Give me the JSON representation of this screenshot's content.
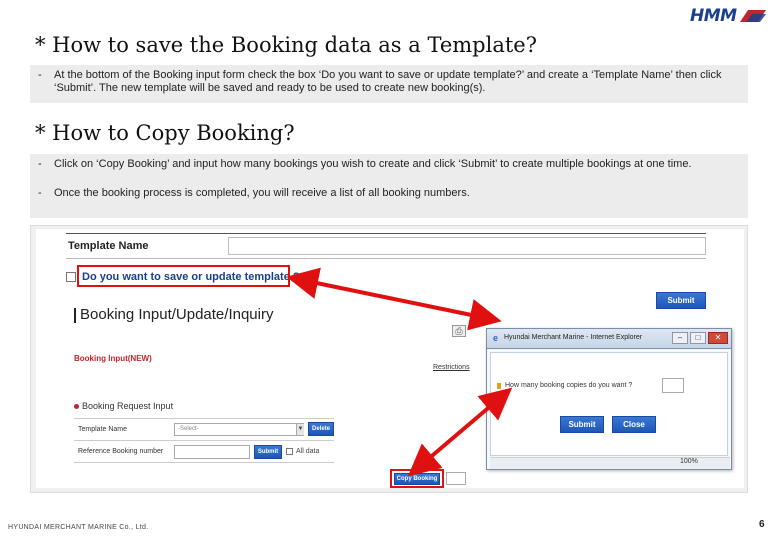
{
  "logo": {
    "text": "HMM"
  },
  "section1": {
    "heading": "* How to save the Booking data as a Template?",
    "note": "At the bottom of the Booking input form check the box ‘Do you want to save or update template?’ and create a ‘Template Name’ then click ‘Submit’. The new template will be saved and ready to be used to create new booking(s)."
  },
  "section2": {
    "heading": "* How to Copy Booking?",
    "notes": [
      "Click on ‘Copy Booking’ and input how many bookings you wish to create and click ‘Submit’ to create multiple bookings at one time.",
      "Once the booking process is completed, you will receive a list of all booking numbers."
    ]
  },
  "form": {
    "template_name_label": "Template Name",
    "save_template_question": "Do you want to save or update template ?",
    "submit_label": "Submit",
    "title": "Booking Input/Update/Inquiry",
    "booking_input_new": "Booking Input(NEW)",
    "restrictions_link": "Restrictions",
    "booking_request_input": "Booking Request Input",
    "template_name_row_label": "Template Name",
    "template_select_value": "-Select-",
    "delete_label": "Delete",
    "reference_booking_label": "Reference Booking number",
    "submit_small_label": "Submit",
    "allow_label": "All data",
    "copy_booking_label": "Copy Booking"
  },
  "popup": {
    "title": "Hyundai Merchant Marine - Internet Explorer",
    "question": "How many booking copies do you want ?",
    "submit_label": "Submit",
    "close_label": "Close",
    "zoom": "100%"
  },
  "footer": {
    "company": "HYUNDAI MERCHANT MARINE Co., Ltd.",
    "page_number": "6"
  },
  "colors": {
    "accent_red": "#e01010",
    "button_blue": "#1d56b8",
    "brand_blue": "#1c3f8f"
  }
}
